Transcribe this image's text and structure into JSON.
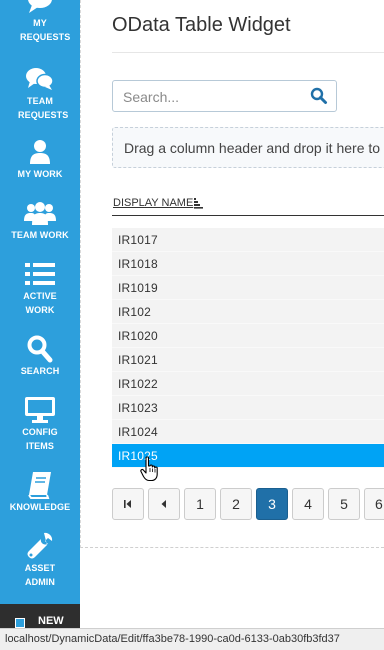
{
  "sidebar": {
    "items": [
      {
        "label": "MY REQUESTS",
        "icon": "speech-bubble-icon"
      },
      {
        "label": "TEAM REQUESTS",
        "icon": "chat-bubbles-icon"
      },
      {
        "label": "MY WORK",
        "icon": "user-icon"
      },
      {
        "label": "TEAM WORK",
        "icon": "users-icon"
      },
      {
        "label": "ACTIVE WORK",
        "icon": "list-icon"
      },
      {
        "label": "SEARCH",
        "icon": "search-icon"
      },
      {
        "label": "CONFIG ITEMS",
        "icon": "monitor-icon"
      },
      {
        "label": "KNOWLEDGE",
        "icon": "book-icon"
      },
      {
        "label": "ASSET ADMIN",
        "icon": "wrench-icon"
      }
    ],
    "bottom_label": "NEW",
    "color": "#2d9fdc"
  },
  "widget": {
    "title": "OData Table Widget",
    "search_placeholder": "Search...",
    "group_hint": "Drag a column header and drop it here to group by that column",
    "column_header": "DISPLAY NAME",
    "rows": [
      "IR1017",
      "IR1018",
      "IR1019",
      "IR102",
      "IR1020",
      "IR1021",
      "IR1022",
      "IR1023",
      "IR1024",
      "IR1025"
    ],
    "selected_row": "IR1025",
    "pager": {
      "first_icon": "first-page-icon",
      "prev_icon": "prev-page-icon",
      "pages": [
        "1",
        "2",
        "3",
        "4",
        "5",
        "6"
      ],
      "current_page": "3"
    },
    "selected_color": "#00a3f5",
    "active_page_color": "#2070a8"
  },
  "status_bar": {
    "url": "localhost/DynamicData/Edit/ffa3be78-1990-ca0d-6133-0ab30fb3fd37"
  }
}
